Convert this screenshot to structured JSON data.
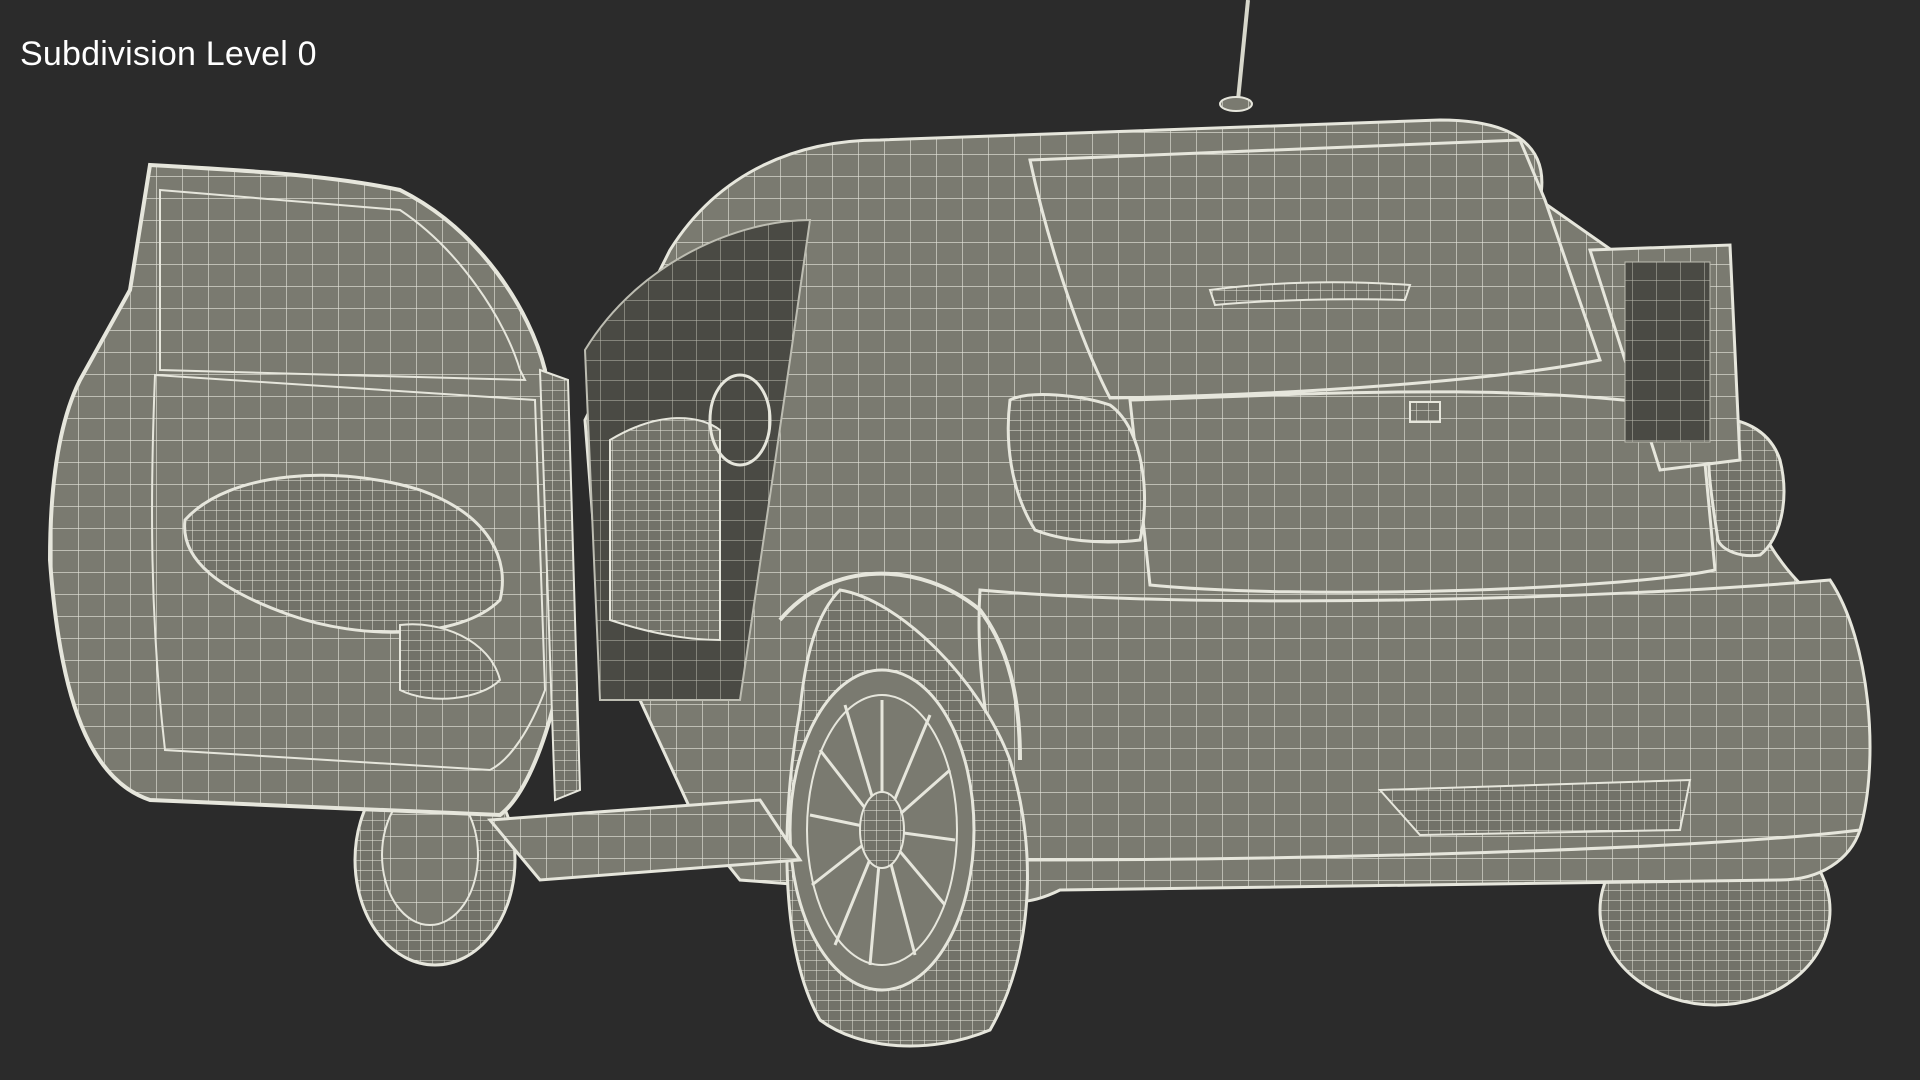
{
  "viewport": {
    "label": "Subdivision Level 0",
    "background_color": "#2b2b2b",
    "model_color": "#7a7a70",
    "wire_color": "#e6e6dc"
  }
}
